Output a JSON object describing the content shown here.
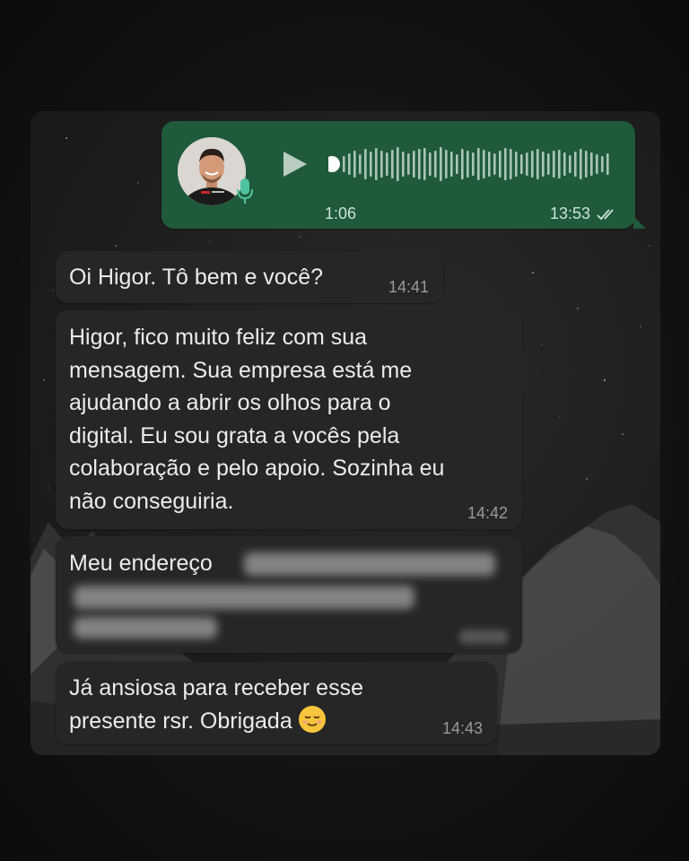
{
  "voice_message": {
    "duration": "1:06",
    "time": "13:53",
    "play_icon": "play-icon",
    "mic_icon": "microphone-icon",
    "receipt_icon": "double-check-icon",
    "accent_color": "#1f5a3b"
  },
  "messages": [
    {
      "text": "Oi Higor. Tô bem e você?",
      "time": "14:41"
    },
    {
      "text": "Higor, fico muito feliz com sua\nmensagem. Sua empresa está me\najudando a abrir os olhos para o\ndigital. Eu sou grata a vocês pela\ncolaboração e pelo apoio. Sozinha eu\nnão conseguiria.",
      "time": "14:42"
    },
    {
      "text": "Meu endereço"
    },
    {
      "text": "Já ansiosa para receber esse\npresente rsr. Obrigada",
      "time": "14:43",
      "emoji": "relieved-face-emoji"
    }
  ],
  "colors": {
    "incoming_bubble": "#262626",
    "outgoing_bubble": "#1f5a3b",
    "timestamp": "#9a9a9a"
  }
}
